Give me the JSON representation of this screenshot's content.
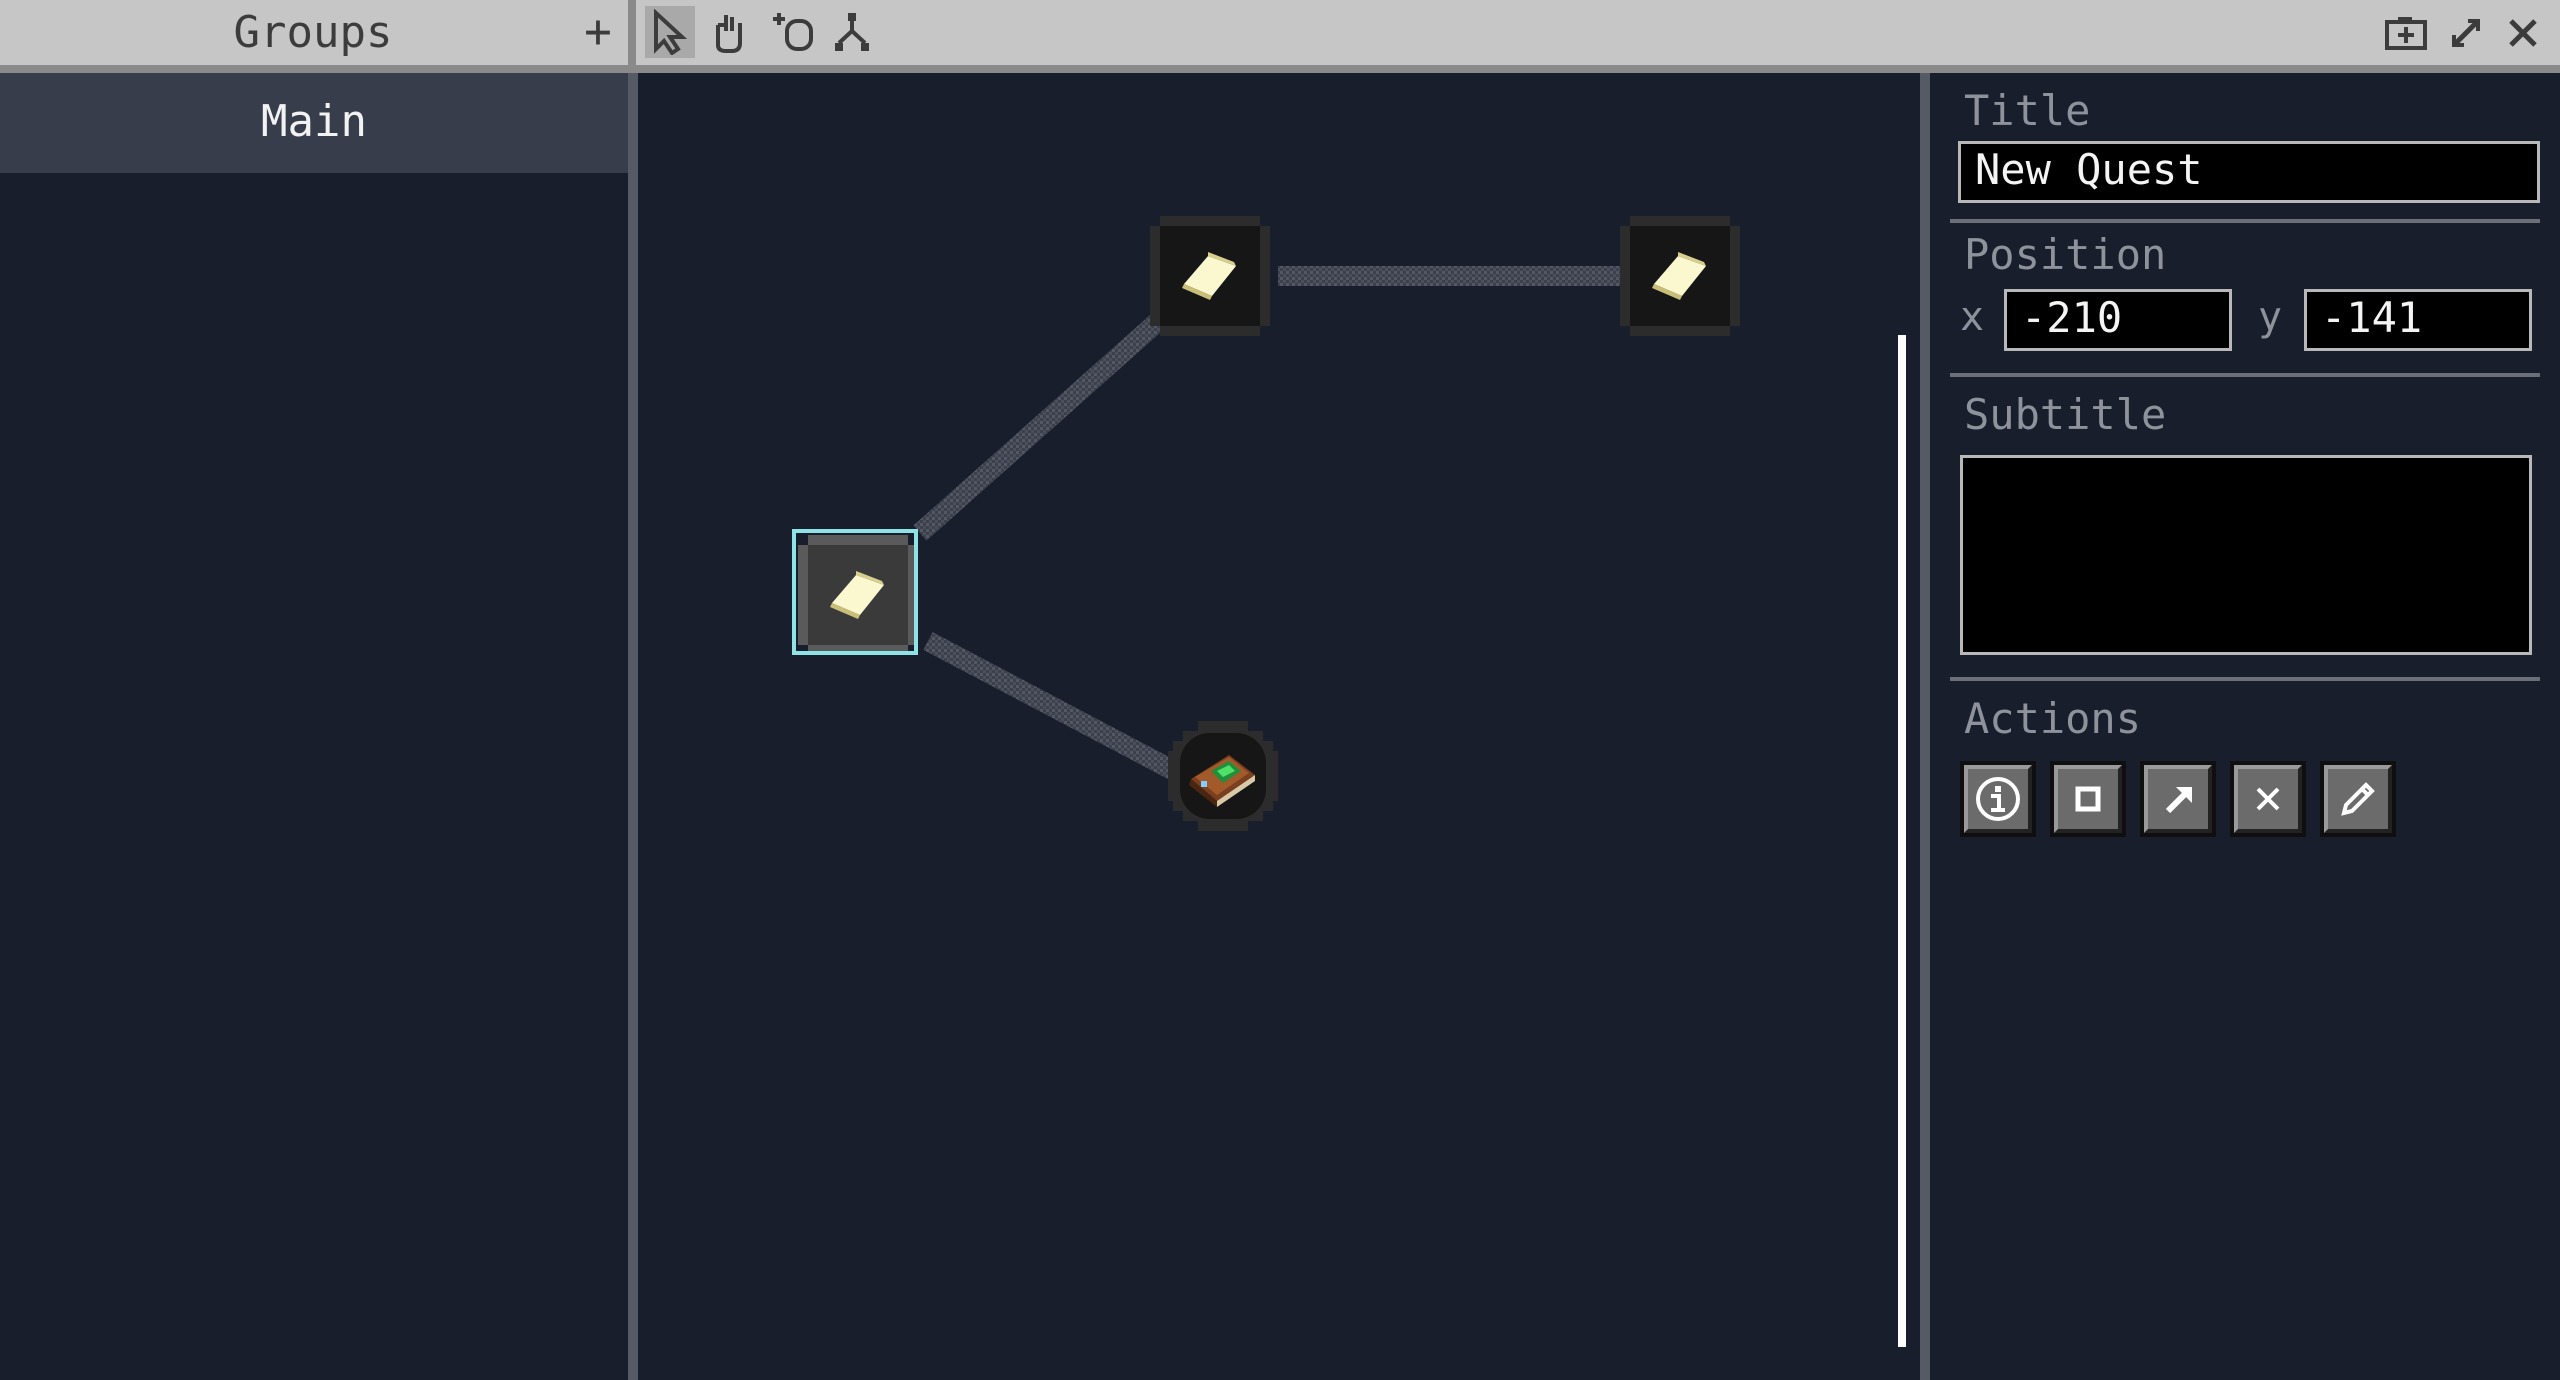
{
  "topbar": {
    "groups_title": "Groups",
    "add_group_label": "+",
    "tools": [
      "select-tool",
      "pan-tool",
      "add-quest-tool",
      "connect-tool"
    ],
    "active_tool": "select-tool",
    "window_controls": [
      "screenshot-icon",
      "resize-icon",
      "close-icon"
    ]
  },
  "sidebar": {
    "groups": [
      {
        "label": "Main",
        "selected": true
      }
    ]
  },
  "canvas": {
    "nodes": [
      {
        "name": "quest-node-selected",
        "icon": "paper-icon",
        "shape": "square",
        "selected": true
      },
      {
        "name": "quest-node-top",
        "icon": "paper-icon",
        "shape": "square",
        "selected": false
      },
      {
        "name": "quest-node-right",
        "icon": "paper-icon",
        "shape": "square",
        "selected": false
      },
      {
        "name": "quest-node-book",
        "icon": "book-icon",
        "shape": "round",
        "selected": false
      }
    ],
    "connections": [
      [
        "quest-node-selected",
        "quest-node-top"
      ],
      [
        "quest-node-top",
        "quest-node-right"
      ],
      [
        "quest-node-selected",
        "quest-node-book"
      ]
    ]
  },
  "panel": {
    "title_label": "Title",
    "title_value": "New Quest",
    "position_label": "Position",
    "x_label": "x",
    "x_value": "-210",
    "y_label": "y",
    "y_value": "-141",
    "subtitle_label": "Subtitle",
    "subtitle_value": "",
    "actions_label": "Actions",
    "actions": [
      "info-icon",
      "square-icon",
      "arrow-icon",
      "delete-icon",
      "edit-icon"
    ]
  },
  "colors": {
    "background": "#181e2c",
    "topbar": "#c6c6c6",
    "selection": "#8fe3e6",
    "panel_label": "#8d929b"
  }
}
